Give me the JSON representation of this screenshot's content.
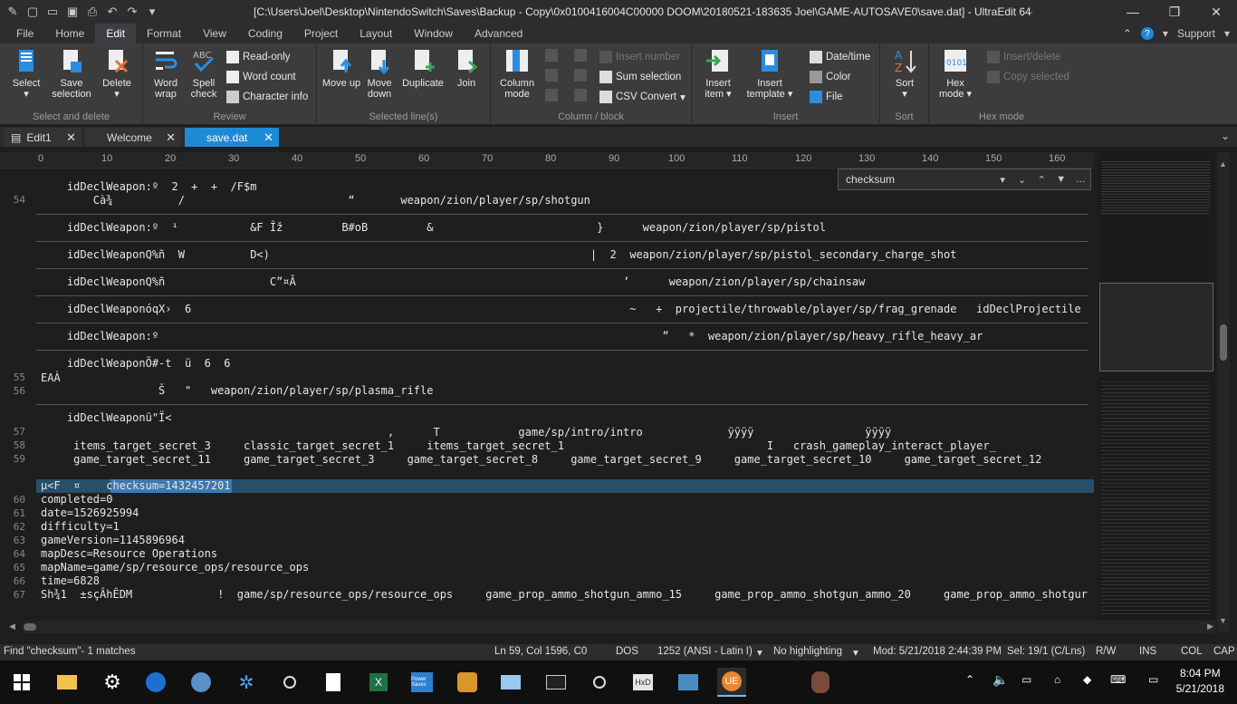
{
  "window": {
    "title": "[C:\\Users\\Joel\\Desktop\\NintendoSwitch\\Saves\\Backup - Copy\\0x0100416004C00000 DOOM\\20180521-183635 Joel\\GAME-AUTOSAVE0\\save.dat] - UltraEdit 64-bit"
  },
  "menu": {
    "items": [
      "File",
      "Home",
      "Edit",
      "Format",
      "View",
      "Coding",
      "Project",
      "Layout",
      "Window",
      "Advanced"
    ],
    "active": "Edit",
    "support_label": "Support"
  },
  "ribbon": {
    "groups": {
      "select_delete": "Select and delete",
      "review": "Review",
      "selected_lines": "Selected line(s)",
      "column_block": "Column / block",
      "insert": "Insert",
      "sort": "Sort",
      "hex_mode": "Hex mode"
    },
    "buttons": {
      "select": "Select",
      "save_selection": "Save selection",
      "delete": "Delete",
      "word_wrap": "Word wrap",
      "spell_check": "Spell check",
      "read_only": "Read-only",
      "word_count": "Word count",
      "character_info": "Character info",
      "move_up": "Move up",
      "move_down": "Move down",
      "duplicate": "Duplicate",
      "join": "Join",
      "column_mode": "Column mode",
      "insert_number": "Insert number",
      "sum_selection": "Sum selection",
      "csv_convert": "CSV Convert",
      "insert_item": "Insert item",
      "insert_template": "Insert template",
      "date_time": "Date/time",
      "color": "Color",
      "file": "File",
      "sort": "Sort",
      "hex_mode": "Hex mode",
      "insert_delete": "Insert/delete",
      "copy_selected": "Copy selected"
    }
  },
  "tabs": [
    {
      "label": "Edit1"
    },
    {
      "label": "Welcome"
    },
    {
      "label": "save.dat"
    }
  ],
  "ruler": {
    "ticks": [
      "0",
      "10",
      "20",
      "30",
      "40",
      "50",
      "60",
      "70",
      "80",
      "90",
      "100",
      "110",
      "120",
      "130",
      "140",
      "150",
      "160"
    ]
  },
  "find": {
    "query": "checksum"
  },
  "editor": {
    "line_numbers": [
      "54",
      "55",
      "56",
      "57",
      "58",
      "59",
      "60",
      "61",
      "62",
      "63",
      "64",
      "65",
      "66",
      "67"
    ],
    "lines": [
      "    idDeclWeapon:º  2  +  +  /F$m",
      "        Cà¾          /                         “       weapon/zion/player/sp/shotgun",
      "    idDeclWeapon:º  ¹           &F Îž         B#oB         &                         }      weapon/zion/player/sp/pistol",
      "    idDeclWeaponQ%ñ  W          D<)                                                 |  2  weapon/zion/player/sp/pistol_secondary_charge_shot",
      "    idDeclWeaponQ%ñ                C”¤Ã                                                  ’      weapon/zion/player/sp/chainsaw",
      "    idDeclWeaponóqX›  6                                                                   ~   +  projectile/throwable/player/sp/frag_grenade   idDeclProjectile",
      "    idDeclWeapon:º                                                                             ”   *  weapon/zion/player/sp/heavy_rifle_heavy_ar",
      "    idDeclWeaponÕ#-t  ü  6  6",
      "EAÀ",
      "                  Š   \"   weapon/zion/player/sp/plasma_rifle",
      "    idDeclWeaponü\"Ï<",
      "                                                     ,      T            game/sp/intro/intro             ÿÿÿÿ                 ÿÿÿÿ",
      "     items_target_secret_3     classic_target_secret_1     items_target_secret_1                               I   crash_gameplay_interact_player_",
      "     game_target_secret_11     game_target_secret_3     game_target_secret_8     game_target_secret_9     game_target_secret_10     game_target_secret_12",
      "µ<F  ¤    checksum=1432457201",
      "completed=0",
      "date=1526925994",
      "difficulty=1",
      "gameVersion=1145896964",
      "mapDesc=Resource Operations",
      "mapName=game/sp/resource_ops/resource_ops",
      "time=6828",
      "Sh¾1  ±sçÂhÊDM             !  game/sp/resource_ops/resource_ops     game_prop_ammo_shotgun_ammo_15     game_prop_ammo_shotgun_ammo_20     game_prop_ammo_shotgur"
    ]
  },
  "status": {
    "find_result": "Find \"checksum\"- 1 matches",
    "position": "Ln 59, Col 1596, C0",
    "line_ending": "DOS",
    "encoding": "1252  (ANSI - Latin I)",
    "highlighting": "No highlighting",
    "modified": "Mod: 5/21/2018 2:44:39 PM",
    "selection": "Sel: 19/1 (C/Lns)",
    "rw": "R/W",
    "ins": "INS",
    "col": "COL",
    "cap": "CAP"
  },
  "taskbar": {
    "time": "8:04 PM",
    "date": "5/21/2018"
  },
  "colors": {
    "accent": "#1e8ad6",
    "highlight_line": "#264f6a",
    "selection": "#3e79b0"
  }
}
